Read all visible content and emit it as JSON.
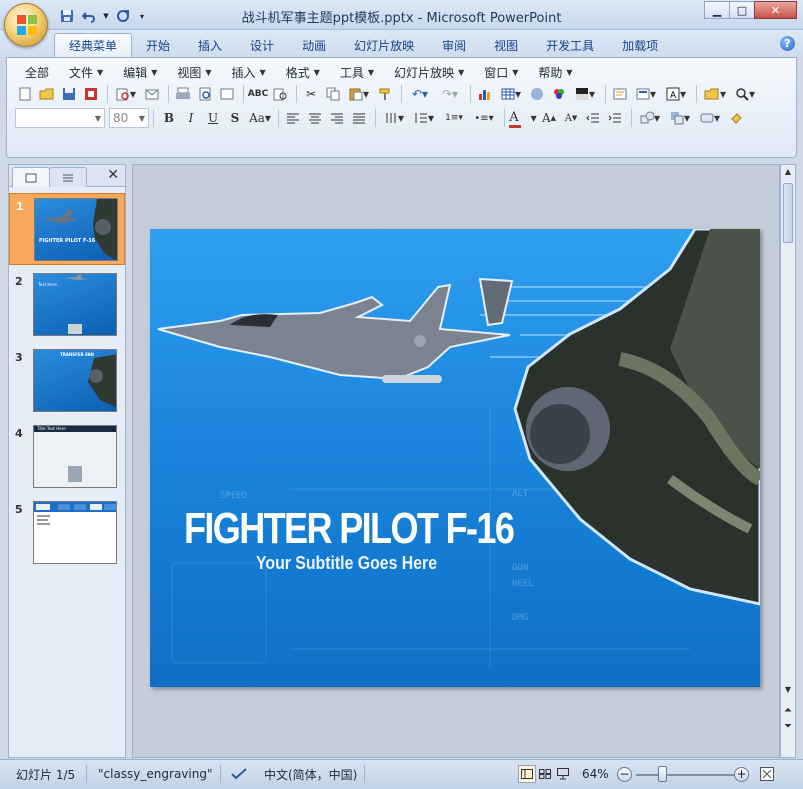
{
  "window": {
    "title": "战斗机军事主题ppt模板.pptx - Microsoft PowerPoint",
    "minimize": "▁",
    "maximize": "□",
    "close": "✕"
  },
  "ribbon": {
    "tabs": [
      "经典菜单",
      "开始",
      "插入",
      "设计",
      "动画",
      "幻灯片放映",
      "审阅",
      "视图",
      "开发工具",
      "加载项"
    ],
    "active_tab": "经典菜单",
    "help": "?"
  },
  "menu": {
    "items": [
      "全部",
      "文件",
      "编辑",
      "视图",
      "插入",
      "格式",
      "工具",
      "幻灯片放映",
      "窗口",
      "帮助"
    ]
  },
  "format": {
    "font_name": "",
    "font_size": "80",
    "font_color_letter": "A"
  },
  "slides_pane": {
    "slides": [
      {
        "num": "1",
        "title": "FIGHTER PILOT F-16"
      },
      {
        "num": "2",
        "title": "Text Here"
      },
      {
        "num": "3",
        "title": "TRANSFER FAN"
      },
      {
        "num": "4",
        "title": "Title Text Here"
      },
      {
        "num": "5",
        "title": ""
      }
    ],
    "selected": 1
  },
  "slide": {
    "title": "FIGHTER PILOT F-16",
    "subtitle": "Your Subtitle Goes Here",
    "hud": [
      "SPEED",
      "ALT",
      "GUN",
      "HEEL",
      "DMG"
    ]
  },
  "status": {
    "slide_indicator": "幻灯片 1/5",
    "theme": "\"classy_engraving\"",
    "language": "中文(简体，中国)",
    "zoom": "64%"
  },
  "colors": {
    "slide_blue": "#1a86dd",
    "accent_orange": "#f7a85a"
  }
}
